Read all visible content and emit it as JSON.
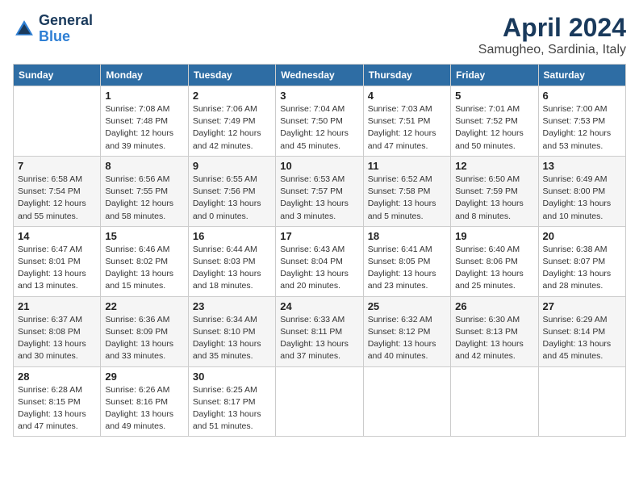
{
  "logo": {
    "line1": "General",
    "line2": "Blue"
  },
  "title": "April 2024",
  "subtitle": "Samugheo, Sardinia, Italy",
  "headers": [
    "Sunday",
    "Monday",
    "Tuesday",
    "Wednesday",
    "Thursday",
    "Friday",
    "Saturday"
  ],
  "weeks": [
    [
      {
        "day": "",
        "info": ""
      },
      {
        "day": "1",
        "info": "Sunrise: 7:08 AM\nSunset: 7:48 PM\nDaylight: 12 hours\nand 39 minutes."
      },
      {
        "day": "2",
        "info": "Sunrise: 7:06 AM\nSunset: 7:49 PM\nDaylight: 12 hours\nand 42 minutes."
      },
      {
        "day": "3",
        "info": "Sunrise: 7:04 AM\nSunset: 7:50 PM\nDaylight: 12 hours\nand 45 minutes."
      },
      {
        "day": "4",
        "info": "Sunrise: 7:03 AM\nSunset: 7:51 PM\nDaylight: 12 hours\nand 47 minutes."
      },
      {
        "day": "5",
        "info": "Sunrise: 7:01 AM\nSunset: 7:52 PM\nDaylight: 12 hours\nand 50 minutes."
      },
      {
        "day": "6",
        "info": "Sunrise: 7:00 AM\nSunset: 7:53 PM\nDaylight: 12 hours\nand 53 minutes."
      }
    ],
    [
      {
        "day": "7",
        "info": "Sunrise: 6:58 AM\nSunset: 7:54 PM\nDaylight: 12 hours\nand 55 minutes."
      },
      {
        "day": "8",
        "info": "Sunrise: 6:56 AM\nSunset: 7:55 PM\nDaylight: 12 hours\nand 58 minutes."
      },
      {
        "day": "9",
        "info": "Sunrise: 6:55 AM\nSunset: 7:56 PM\nDaylight: 13 hours\nand 0 minutes."
      },
      {
        "day": "10",
        "info": "Sunrise: 6:53 AM\nSunset: 7:57 PM\nDaylight: 13 hours\nand 3 minutes."
      },
      {
        "day": "11",
        "info": "Sunrise: 6:52 AM\nSunset: 7:58 PM\nDaylight: 13 hours\nand 5 minutes."
      },
      {
        "day": "12",
        "info": "Sunrise: 6:50 AM\nSunset: 7:59 PM\nDaylight: 13 hours\nand 8 minutes."
      },
      {
        "day": "13",
        "info": "Sunrise: 6:49 AM\nSunset: 8:00 PM\nDaylight: 13 hours\nand 10 minutes."
      }
    ],
    [
      {
        "day": "14",
        "info": "Sunrise: 6:47 AM\nSunset: 8:01 PM\nDaylight: 13 hours\nand 13 minutes."
      },
      {
        "day": "15",
        "info": "Sunrise: 6:46 AM\nSunset: 8:02 PM\nDaylight: 13 hours\nand 15 minutes."
      },
      {
        "day": "16",
        "info": "Sunrise: 6:44 AM\nSunset: 8:03 PM\nDaylight: 13 hours\nand 18 minutes."
      },
      {
        "day": "17",
        "info": "Sunrise: 6:43 AM\nSunset: 8:04 PM\nDaylight: 13 hours\nand 20 minutes."
      },
      {
        "day": "18",
        "info": "Sunrise: 6:41 AM\nSunset: 8:05 PM\nDaylight: 13 hours\nand 23 minutes."
      },
      {
        "day": "19",
        "info": "Sunrise: 6:40 AM\nSunset: 8:06 PM\nDaylight: 13 hours\nand 25 minutes."
      },
      {
        "day": "20",
        "info": "Sunrise: 6:38 AM\nSunset: 8:07 PM\nDaylight: 13 hours\nand 28 minutes."
      }
    ],
    [
      {
        "day": "21",
        "info": "Sunrise: 6:37 AM\nSunset: 8:08 PM\nDaylight: 13 hours\nand 30 minutes."
      },
      {
        "day": "22",
        "info": "Sunrise: 6:36 AM\nSunset: 8:09 PM\nDaylight: 13 hours\nand 33 minutes."
      },
      {
        "day": "23",
        "info": "Sunrise: 6:34 AM\nSunset: 8:10 PM\nDaylight: 13 hours\nand 35 minutes."
      },
      {
        "day": "24",
        "info": "Sunrise: 6:33 AM\nSunset: 8:11 PM\nDaylight: 13 hours\nand 37 minutes."
      },
      {
        "day": "25",
        "info": "Sunrise: 6:32 AM\nSunset: 8:12 PM\nDaylight: 13 hours\nand 40 minutes."
      },
      {
        "day": "26",
        "info": "Sunrise: 6:30 AM\nSunset: 8:13 PM\nDaylight: 13 hours\nand 42 minutes."
      },
      {
        "day": "27",
        "info": "Sunrise: 6:29 AM\nSunset: 8:14 PM\nDaylight: 13 hours\nand 45 minutes."
      }
    ],
    [
      {
        "day": "28",
        "info": "Sunrise: 6:28 AM\nSunset: 8:15 PM\nDaylight: 13 hours\nand 47 minutes."
      },
      {
        "day": "29",
        "info": "Sunrise: 6:26 AM\nSunset: 8:16 PM\nDaylight: 13 hours\nand 49 minutes."
      },
      {
        "day": "30",
        "info": "Sunrise: 6:25 AM\nSunset: 8:17 PM\nDaylight: 13 hours\nand 51 minutes."
      },
      {
        "day": "",
        "info": ""
      },
      {
        "day": "",
        "info": ""
      },
      {
        "day": "",
        "info": ""
      },
      {
        "day": "",
        "info": ""
      }
    ]
  ]
}
